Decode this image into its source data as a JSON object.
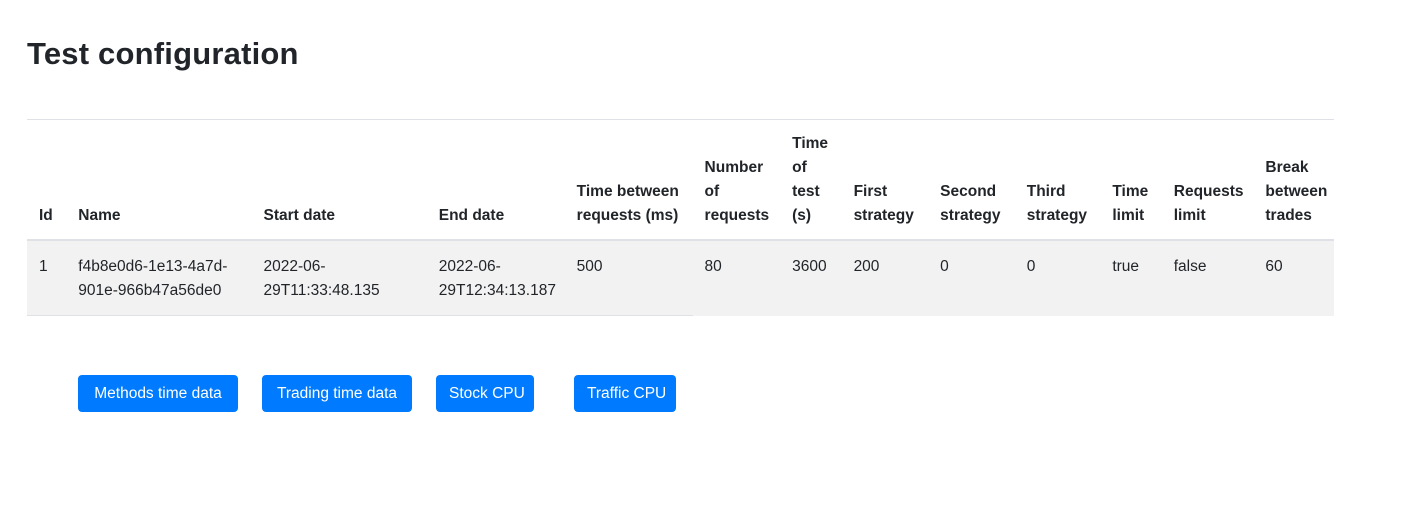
{
  "page": {
    "title": "Test configuration"
  },
  "table": {
    "headers": [
      "Id",
      "Name",
      "Start date",
      "End date",
      "Time between requests (ms)",
      "Number of requests",
      "Time of test (s)",
      "First strategy",
      "Second strategy",
      "Third strategy",
      "Time limit",
      "Requests limit",
      "Break between trades"
    ],
    "rows": [
      [
        "1",
        "f4b8e0d6-1e13-4a7d-901e-966b47a56de0",
        "2022-06-29T11:33:48.135",
        "2022-06-29T12:34:13.187",
        "500",
        "80",
        "3600",
        "200",
        "0",
        "0",
        "true",
        "false",
        "60"
      ]
    ]
  },
  "buttons": {
    "methods_time": "Methods time data",
    "trading_time": "Trading time data",
    "stock_cpu": "Stock CPU",
    "traffic_cpu": "Traffic CPU"
  },
  "colors": {
    "primary_button": "#007bff",
    "row_background": "#f2f2f2",
    "border": "#dee2e6"
  }
}
